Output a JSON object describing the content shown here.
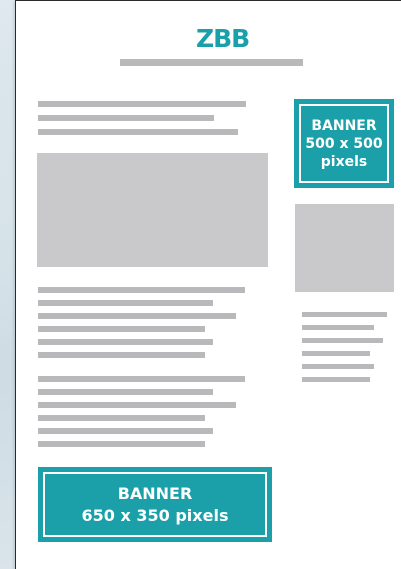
{
  "header": {
    "logo_text": "ZBB"
  },
  "banners": {
    "side": {
      "line1": "BANNER",
      "line2": "500 x 500",
      "line3": "pixels"
    },
    "bottom": {
      "line1": "BANNER",
      "line2": "650 x 350 pixels"
    }
  },
  "colors": {
    "accent": "#1b9fa8",
    "placeholder_text": "#b9b9bb",
    "placeholder_image": "#c9c9cb",
    "page": "#ffffff"
  }
}
